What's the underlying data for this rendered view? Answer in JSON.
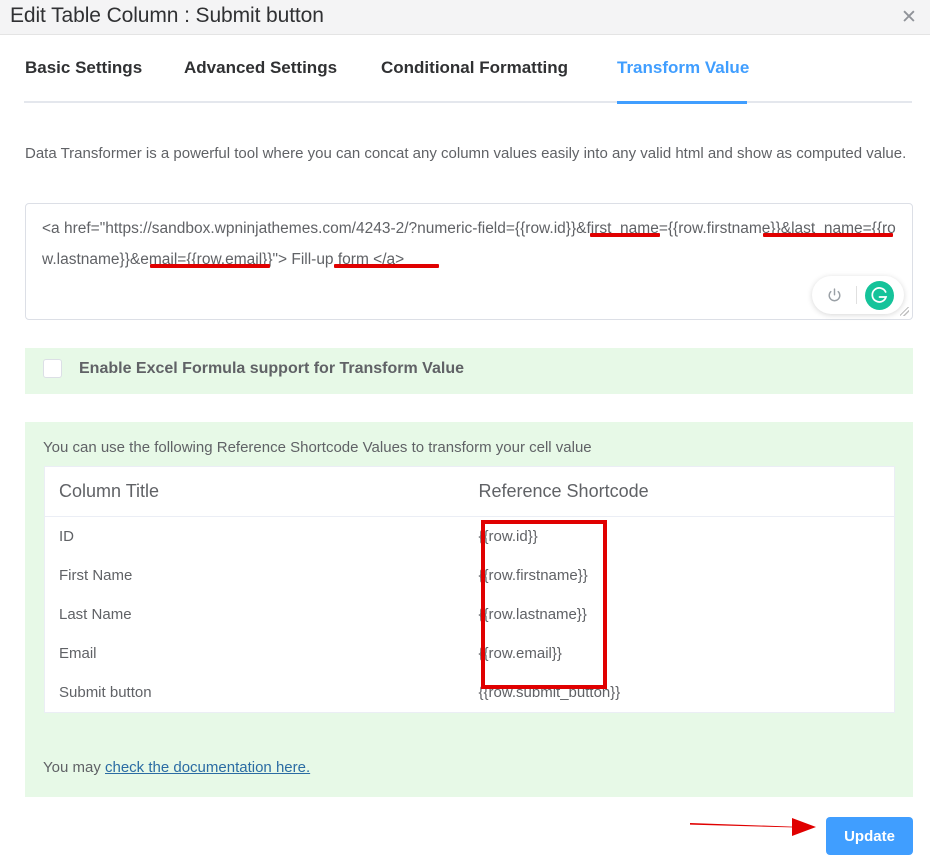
{
  "header": {
    "title": "Edit Table Column : Submit button",
    "close_icon": "close-icon",
    "close_glyph": "✕"
  },
  "tabs": [
    {
      "label": "Basic Settings",
      "active": false
    },
    {
      "label": "Advanced Settings",
      "active": false
    },
    {
      "label": "Conditional Formatting",
      "active": false
    },
    {
      "label": "Transform Value",
      "active": true
    }
  ],
  "description": "Data Transformer is a powerful tool where you can concat any column values easily into any valid html and show as computed value.",
  "editor": {
    "value": "<a href=\"https://sandbox.wpninjathemes.com/4243-2/?numeric-field={{row.id}}&first_name={{row.firstname}}&last_name={{row.lastname}}&email={{row.email}}\"> Fill-up form </a>",
    "grammarly": {
      "power_icon": "power-icon",
      "logo_icon": "grammarly-logo-icon",
      "logo_letter": "G",
      "logo_color": "#15c39a"
    },
    "resize_handle": "resize-grip"
  },
  "excel_option": {
    "label": "Enable Excel Formula support for Transform Value",
    "checked": false
  },
  "reference": {
    "note": "You can use the following Reference Shortcode Values to transform your cell value",
    "columns": [
      "Column Title",
      "Reference Shortcode"
    ],
    "rows": [
      {
        "title": "ID",
        "shortcode": "{{row.id}}"
      },
      {
        "title": "First Name",
        "shortcode": "{{row.firstname}}"
      },
      {
        "title": "Last Name",
        "shortcode": "{{row.lastname}}"
      },
      {
        "title": "Email",
        "shortcode": "{{row.email}}"
      },
      {
        "title": "Submit button",
        "shortcode": "{{row.submit_button}}"
      }
    ],
    "doc_prefix": "You may ",
    "doc_link": "check the documentation here."
  },
  "footer": {
    "update_label": "Update"
  },
  "annotations": {
    "underlines": [
      "{{row.id}}",
      "{{row.firstname}}",
      "{{row.lastname}}",
      "{{row.email}}"
    ],
    "box_target": "reference-shortcode-cells",
    "arrow_target": "update-button",
    "color": "#e00000"
  },
  "colors": {
    "accent": "#409eff",
    "header_bg": "#f4f4f5",
    "panel_green": "#e7f9e7",
    "text": "#606266",
    "link": "#2b6ca3"
  }
}
